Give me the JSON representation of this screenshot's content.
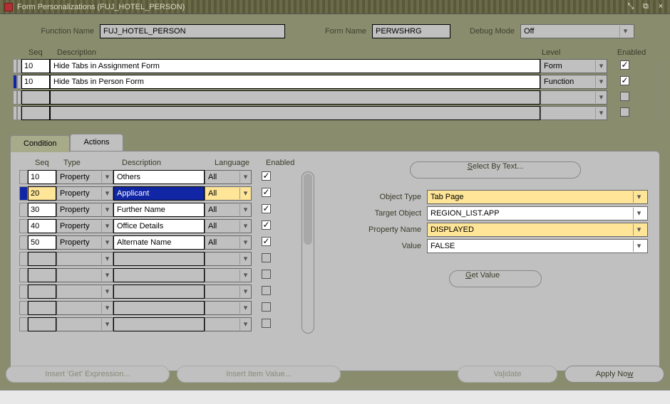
{
  "titlebar": {
    "text": "Form Personalizations (FUJ_HOTEL_PERSON)"
  },
  "top": {
    "function_name_label": "Function Name",
    "function_name": "FUJ_HOTEL_PERSON",
    "form_name_label": "Form Name",
    "form_name": "PERWSHRG",
    "debug_label": "Debug Mode",
    "debug_mode": "Off"
  },
  "rules": {
    "headers": {
      "seq": "Seq",
      "desc": "Description",
      "level": "Level",
      "enabled": "Enabled"
    },
    "rows": [
      {
        "seq": "10",
        "desc": "Hide Tabs in Assignment Form",
        "level": "Form",
        "enabled": true,
        "current": false
      },
      {
        "seq": "10",
        "desc": "Hide Tabs in Person Form",
        "level": "Function",
        "enabled": true,
        "current": true
      },
      {
        "seq": "",
        "desc": "",
        "level": "",
        "enabled": null
      },
      {
        "seq": "",
        "desc": "",
        "level": "",
        "enabled": null
      }
    ]
  },
  "tabs": {
    "condition": "Condition",
    "actions": "Actions"
  },
  "actions": {
    "headers": {
      "seq": "Seq",
      "type": "Type",
      "desc": "Description",
      "lang": "Language",
      "enabled": "Enabled"
    },
    "rows": [
      {
        "seq": "10",
        "type": "Property",
        "desc": "Others",
        "lang": "All",
        "enabled": true
      },
      {
        "seq": "20",
        "type": "Property",
        "desc": "Applicant",
        "lang": "All",
        "enabled": true,
        "hl": true
      },
      {
        "seq": "30",
        "type": "Property",
        "desc": "Further Name",
        "lang": "All",
        "enabled": true
      },
      {
        "seq": "40",
        "type": "Property",
        "desc": "Office Details",
        "lang": "All",
        "enabled": true
      },
      {
        "seq": "50",
        "type": "Property",
        "desc": "Alternate Name",
        "lang": "All",
        "enabled": true
      },
      {
        "seq": "",
        "type": "",
        "desc": "",
        "lang": "",
        "enabled": null
      },
      {
        "seq": "",
        "type": "",
        "desc": "",
        "lang": "",
        "enabled": null
      },
      {
        "seq": "",
        "type": "",
        "desc": "",
        "lang": "",
        "enabled": null
      },
      {
        "seq": "",
        "type": "",
        "desc": "",
        "lang": "",
        "enabled": null
      },
      {
        "seq": "",
        "type": "",
        "desc": "",
        "lang": "",
        "enabled": null
      }
    ]
  },
  "detail": {
    "select_by_text": "Select By Text...",
    "object_type_label": "Object Type",
    "object_type": "Tab Page",
    "target_object_label": "Target Object",
    "target_object": "REGION_LIST.APP",
    "property_name_label": "Property Name",
    "property_name": "DISPLAYED",
    "value_label": "Value",
    "value": "FALSE",
    "get_value": "Get Value",
    "get_value_mn": "G"
  },
  "bottom": {
    "insert_get": "Insert 'Get' Expression...",
    "insert_item": "Insert Item Value...",
    "validate": "Validate",
    "apply_now": "Apply Now"
  }
}
